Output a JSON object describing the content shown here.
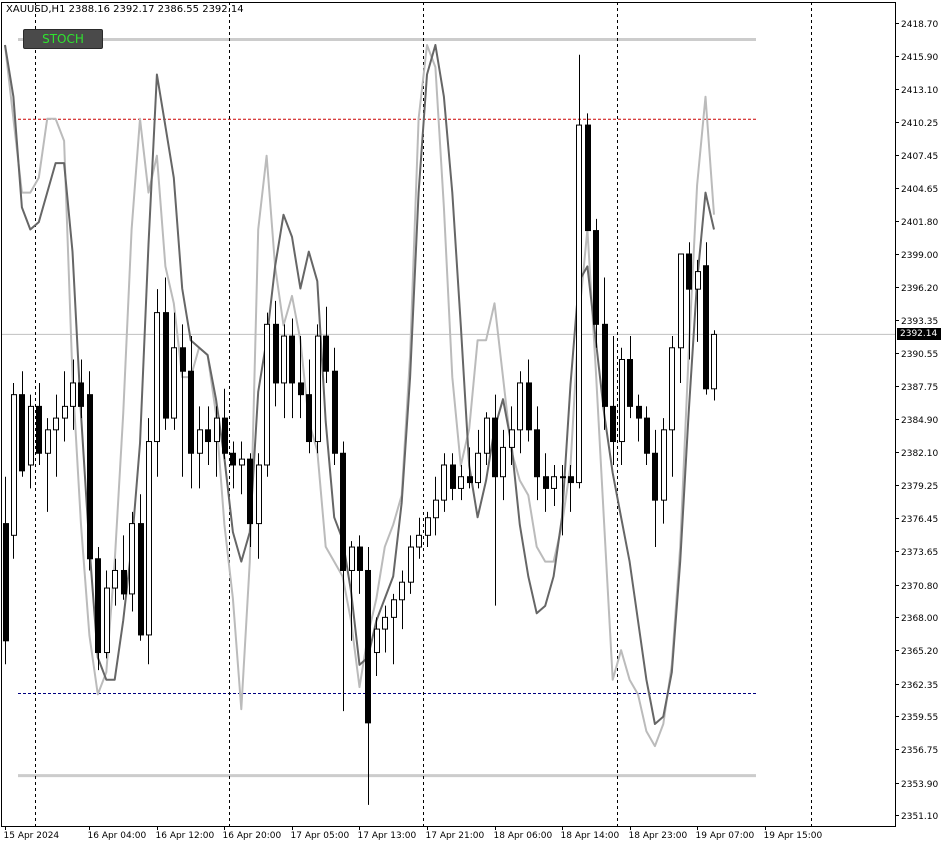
{
  "window": {
    "symbol_title": "XAUUSD,H1  2388.16 2392.17 2386.55 2392.14",
    "indicator_button": "STOCH",
    "current_price_label": "2392.14"
  },
  "colors": {
    "background": "#ffffff",
    "frame": "#000000",
    "bull_candle_fill": "#ffffff",
    "bear_candle_fill": "#000000",
    "stoch_main": "#666666",
    "stoch_signal": "#bbbbbb",
    "level_band": "#cccccc",
    "upper_level": "#cc0000",
    "lower_level": "#000080",
    "button_bg": "#4a4a4a",
    "button_text": "#2fe22f"
  },
  "chart_data": {
    "type": "candlestick",
    "symbol": "XAUUSD",
    "timeframe": "H1",
    "ylim": [
      2350.2,
      2420.5
    ],
    "y_ticks": [
      "2418.70",
      "2415.90",
      "2413.10",
      "2410.25",
      "2407.45",
      "2404.65",
      "2401.80",
      "2399.00",
      "2396.20",
      "2393.35",
      "2390.55",
      "2387.75",
      "2384.90",
      "2382.10",
      "2379.25",
      "2376.45",
      "2373.65",
      "2370.80",
      "2368.00",
      "2365.20",
      "2362.35",
      "2359.55",
      "2356.75",
      "2353.90",
      "2351.10"
    ],
    "x_ticks": [
      "15 Apr 2024",
      "16 Apr 04:00",
      "16 Apr 12:00",
      "16 Apr 20:00",
      "17 Apr 05:00",
      "17 Apr 13:00",
      "17 Apr 21:00",
      "18 Apr 06:00",
      "18 Apr 14:00",
      "18 Apr 23:00",
      "19 Apr 07:00",
      "19 Apr 15:00"
    ],
    "x_tick_bars": [
      0,
      10,
      18,
      26,
      34,
      42,
      50,
      58,
      66,
      74,
      82,
      90
    ],
    "session_separator_bars": [
      4,
      27,
      50,
      73,
      96
    ],
    "current_price": 2392.14,
    "horizontal_levels": {
      "upper_band": 2417.3,
      "upper_dashed": 2410.5,
      "lower_dashed": 2361.5,
      "lower_band": 2354.5
    },
    "candles": [
      [
        2376.0,
        2380.0,
        2364.0,
        2366.0
      ],
      [
        2375.0,
        2388.0,
        2373.0,
        2387.0
      ],
      [
        2387.0,
        2389.0,
        2380.0,
        2380.5
      ],
      [
        2381.0,
        2387.0,
        2379.0,
        2386.0
      ],
      [
        2386.0,
        2388.0,
        2381.0,
        2382.0
      ],
      [
        2382.0,
        2385.0,
        2377.0,
        2384.0
      ],
      [
        2384.0,
        2387.0,
        2380.0,
        2385.0
      ],
      [
        2385.0,
        2389.0,
        2383.0,
        2386.0
      ],
      [
        2386.0,
        2390.0,
        2384.0,
        2388.0
      ],
      [
        2388.0,
        2390.0,
        2385.0,
        2386.0
      ],
      [
        2387.0,
        2389.0,
        2372.0,
        2373.0
      ],
      [
        2373.0,
        2374.0,
        2363.5,
        2365.0
      ],
      [
        2365.0,
        2372.0,
        2364.5,
        2370.5
      ],
      [
        2370.5,
        2373.0,
        2369.0,
        2372.0
      ],
      [
        2372.0,
        2375.0,
        2369.5,
        2370.0
      ],
      [
        2370.0,
        2377.0,
        2368.5,
        2376.0
      ],
      [
        2376.0,
        2378.5,
        2366.0,
        2366.5
      ],
      [
        2366.5,
        2385.0,
        2364.0,
        2383.0
      ],
      [
        2383.0,
        2396.0,
        2380.0,
        2394.0
      ],
      [
        2394.0,
        2397.0,
        2384.0,
        2385.0
      ],
      [
        2385.0,
        2394.0,
        2384.0,
        2391.0
      ],
      [
        2391.0,
        2393.0,
        2380.0,
        2389.0
      ],
      [
        2389.0,
        2392.0,
        2379.0,
        2382.0
      ],
      [
        2382.0,
        2386.0,
        2379.0,
        2384.0
      ],
      [
        2384.0,
        2386.0,
        2381.0,
        2383.0
      ],
      [
        2383.0,
        2386.0,
        2380.0,
        2385.0
      ],
      [
        2385.0,
        2387.5,
        2381.5,
        2382.0
      ],
      [
        2382.0,
        2383.0,
        2379.0,
        2381.0
      ],
      [
        2381.0,
        2383.0,
        2378.5,
        2381.5
      ],
      [
        2381.5,
        2382.0,
        2374.0,
        2376.0
      ],
      [
        2376.0,
        2382.0,
        2373.0,
        2381.0
      ],
      [
        2381.0,
        2394.0,
        2380.0,
        2393.0
      ],
      [
        2393.0,
        2395.0,
        2386.0,
        2388.0
      ],
      [
        2388.0,
        2393.0,
        2385.0,
        2392.0
      ],
      [
        2392.0,
        2393.5,
        2385.0,
        2388.0
      ],
      [
        2388.0,
        2392.0,
        2385.0,
        2387.0
      ],
      [
        2387.0,
        2390.0,
        2382.0,
        2383.0
      ],
      [
        2383.0,
        2393.0,
        2382.0,
        2392.0
      ],
      [
        2392.0,
        2394.5,
        2388.0,
        2389.0
      ],
      [
        2389.0,
        2391.0,
        2381.0,
        2382.0
      ],
      [
        2382.0,
        2383.0,
        2360.0,
        2372.0
      ],
      [
        2372.0,
        2374.5,
        2366.0,
        2374.0
      ],
      [
        2374.0,
        2375.0,
        2370.0,
        2372.0
      ],
      [
        2372.0,
        2374.0,
        2352.0,
        2359.0
      ],
      [
        2365.0,
        2368.0,
        2363.0,
        2367.0
      ],
      [
        2367.0,
        2369.0,
        2365.0,
        2368.0
      ],
      [
        2368.0,
        2370.0,
        2364.0,
        2369.5
      ],
      [
        2369.5,
        2372.0,
        2367.0,
        2371.0
      ],
      [
        2371.0,
        2375.0,
        2370.0,
        2374.0
      ],
      [
        2374.0,
        2376.5,
        2373.0,
        2375.0
      ],
      [
        2375.0,
        2377.0,
        2374.0,
        2376.5
      ],
      [
        2376.5,
        2380.0,
        2375.0,
        2378.0
      ],
      [
        2378.0,
        2382.0,
        2377.0,
        2381.0
      ],
      [
        2381.0,
        2382.0,
        2378.0,
        2379.0
      ],
      [
        2379.0,
        2381.0,
        2378.0,
        2380.0
      ],
      [
        2380.0,
        2382.5,
        2379.0,
        2379.5
      ],
      [
        2379.5,
        2384.0,
        2379.0,
        2382.0
      ],
      [
        2382.0,
        2385.5,
        2381.0,
        2385.0
      ],
      [
        2385.0,
        2387.0,
        2369.0,
        2380.0
      ],
      [
        2380.0,
        2384.0,
        2378.0,
        2382.5
      ],
      [
        2382.5,
        2386.0,
        2381.0,
        2384.0
      ],
      [
        2384.0,
        2389.0,
        2382.0,
        2388.0
      ],
      [
        2388.0,
        2390.0,
        2383.0,
        2384.0
      ],
      [
        2384.0,
        2386.0,
        2378.0,
        2380.0
      ],
      [
        2380.0,
        2382.0,
        2377.0,
        2379.0
      ],
      [
        2379.0,
        2381.0,
        2377.5,
        2380.0
      ],
      [
        2380.0,
        2381.0,
        2375.0,
        2380.0
      ],
      [
        2380.0,
        2381.0,
        2377.0,
        2379.5
      ],
      [
        2379.5,
        2416.0,
        2379.0,
        2410.0
      ],
      [
        2410.0,
        2411.0,
        2401.0,
        2401.0
      ],
      [
        2401.0,
        2402.0,
        2391.0,
        2393.0
      ],
      [
        2393.0,
        2397.0,
        2384.0,
        2386.0
      ],
      [
        2386.0,
        2392.0,
        2381.0,
        2383.0
      ],
      [
        2383.0,
        2391.0,
        2381.0,
        2390.0
      ],
      [
        2390.0,
        2392.0,
        2385.0,
        2386.0
      ],
      [
        2386.0,
        2387.0,
        2383.0,
        2385.0
      ],
      [
        2385.0,
        2386.0,
        2381.0,
        2382.0
      ],
      [
        2382.0,
        2384.0,
        2374.0,
        2378.0
      ],
      [
        2378.0,
        2385.0,
        2376.0,
        2384.0
      ],
      [
        2384.0,
        2392.0,
        2380.0,
        2391.0
      ],
      [
        2391.0,
        2399.0,
        2388.0,
        2399.0
      ],
      [
        2399.0,
        2400.0,
        2390.0,
        2396.0
      ],
      [
        2396.0,
        2398.5,
        2391.5,
        2397.5
      ],
      [
        2398.0,
        2400.0,
        2387.0,
        2387.5
      ],
      [
        2387.5,
        2392.5,
        2386.5,
        2392.14
      ]
    ],
    "stoch_main": [
      1.0,
      0.93,
      0.78,
      0.75,
      0.76,
      0.8,
      0.84,
      0.84,
      0.72,
      0.5,
      0.32,
      0.17,
      0.14,
      0.14,
      0.22,
      0.32,
      0.46,
      0.73,
      0.96,
      0.89,
      0.82,
      0.67,
      0.6,
      0.59,
      0.58,
      0.52,
      0.44,
      0.34,
      0.3,
      0.34,
      0.53,
      0.6,
      0.7,
      0.77,
      0.74,
      0.67,
      0.72,
      0.68,
      0.49,
      0.36,
      0.33,
      0.26,
      0.16,
      0.17,
      0.22,
      0.25,
      0.28,
      0.38,
      0.55,
      0.8,
      0.96,
      1.0,
      0.93,
      0.8,
      0.62,
      0.43,
      0.36,
      0.41,
      0.48,
      0.52,
      0.46,
      0.35,
      0.28,
      0.23,
      0.24,
      0.28,
      0.36,
      0.54,
      0.68,
      0.7,
      0.6,
      0.5,
      0.42,
      0.36,
      0.3,
      0.22,
      0.14,
      0.08,
      0.09,
      0.15,
      0.3,
      0.5,
      0.68,
      0.8,
      0.75
    ],
    "stoch_signal": [
      1.0,
      0.9,
      0.8,
      0.8,
      0.82,
      0.9,
      0.9,
      0.87,
      0.55,
      0.35,
      0.2,
      0.12,
      0.15,
      0.3,
      0.5,
      0.75,
      0.9,
      0.8,
      0.85,
      0.7,
      0.65,
      0.55,
      0.55,
      0.59,
      0.58,
      0.5,
      0.35,
      0.25,
      0.1,
      0.3,
      0.75,
      0.85,
      0.7,
      0.62,
      0.66,
      0.6,
      0.49,
      0.45,
      0.32,
      0.3,
      0.28,
      0.22,
      0.13,
      0.2,
      0.25,
      0.32,
      0.35,
      0.39,
      0.58,
      0.9,
      1.0,
      0.97,
      0.78,
      0.55,
      0.43,
      0.48,
      0.6,
      0.6,
      0.65,
      0.55,
      0.45,
      0.41,
      0.39,
      0.32,
      0.3,
      0.3,
      0.35,
      0.43,
      0.63,
      0.75,
      0.56,
      0.35,
      0.14,
      0.18,
      0.14,
      0.12,
      0.07,
      0.05,
      0.08,
      0.16,
      0.32,
      0.58,
      0.81,
      0.93,
      0.77
    ]
  }
}
